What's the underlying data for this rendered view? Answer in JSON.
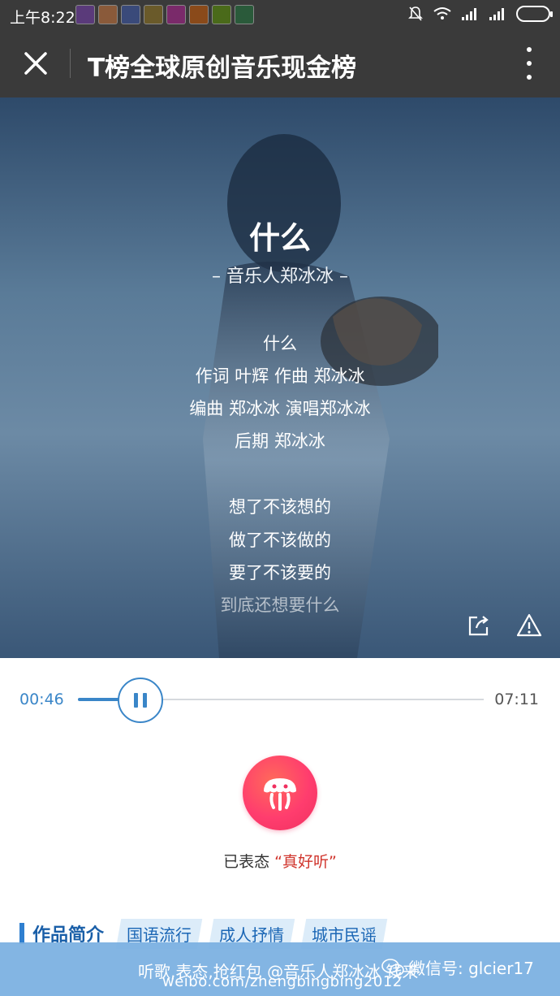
{
  "status_bar": {
    "time": "上午8:22"
  },
  "header": {
    "title": "T榜全球原创音乐现金榜",
    "close_icon": "close-icon",
    "more_icon": "more-vertical-icon"
  },
  "song": {
    "title": "什么",
    "artist": "– 音乐人郑冰冰 –",
    "credits": [
      "什么",
      "作词 叶辉 作曲 郑冰冰",
      "编曲 郑冰冰 演唱郑冰冰",
      "后期 郑冰冰"
    ],
    "lyrics": [
      "想了不该想的",
      "做了不该做的",
      "要了不该要的",
      "到底还想要什么"
    ]
  },
  "player": {
    "current_time": "00:46",
    "total_time": "07:11",
    "progress": 0.107
  },
  "reaction": {
    "prefix": "已表态 ",
    "quoted": "“真好听”"
  },
  "section": {
    "title": "作品简介",
    "tags": [
      "国语流行",
      "成人抒情",
      "城市民谣"
    ]
  },
  "watermark": {
    "line1": "听歌,表态,抢红包 @音乐人郑冰冰 钱来",
    "weibo": "weibo.com/zhengbingbing2012",
    "wechat": "微信号: glcier17"
  },
  "colors": {
    "accent": "#3a86c8",
    "reaction": "#ff3d6e",
    "quote": "#d0342c"
  }
}
